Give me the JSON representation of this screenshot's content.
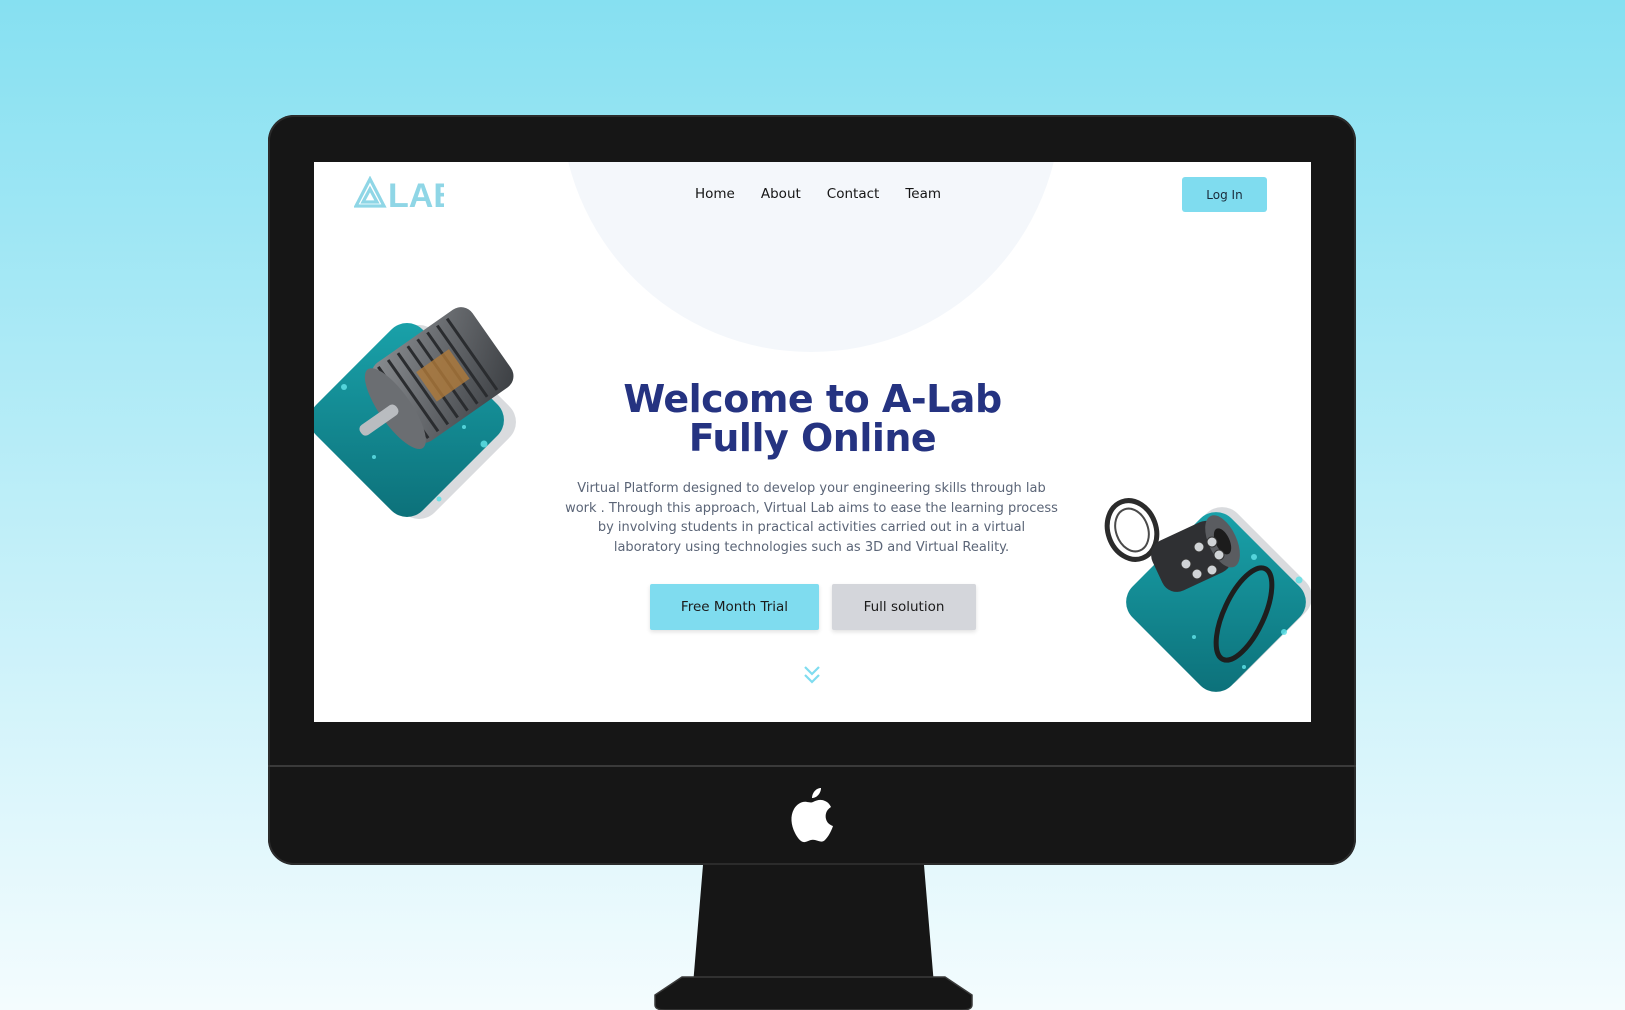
{
  "device": {
    "name": "iMac",
    "logo_icon": "apple-logo-icon"
  },
  "header": {
    "logo_text": "LAB",
    "nav": [
      {
        "label": "Home"
      },
      {
        "label": "About"
      },
      {
        "label": "Contact"
      },
      {
        "label": "Team"
      }
    ],
    "login_label": "Log In"
  },
  "hero": {
    "title_line1": "Welcome to A-Lab",
    "title_line2": "Fully Online",
    "description": "Virtual Platform designed to develop your engineering skills through lab work . Through this approach, Virtual Lab aims to ease the learning process by involving students in practical activities carried out in a virtual laboratory using technologies such as 3D and Virtual Reality.",
    "primary_cta": "Free Month Trial",
    "secondary_cta": "Full solution",
    "scroll_icon": "double-chevron-down-icon"
  },
  "colors": {
    "accent": "#7fdcef",
    "title": "#253381",
    "teal": "#138a93",
    "bezel": "#161616"
  }
}
